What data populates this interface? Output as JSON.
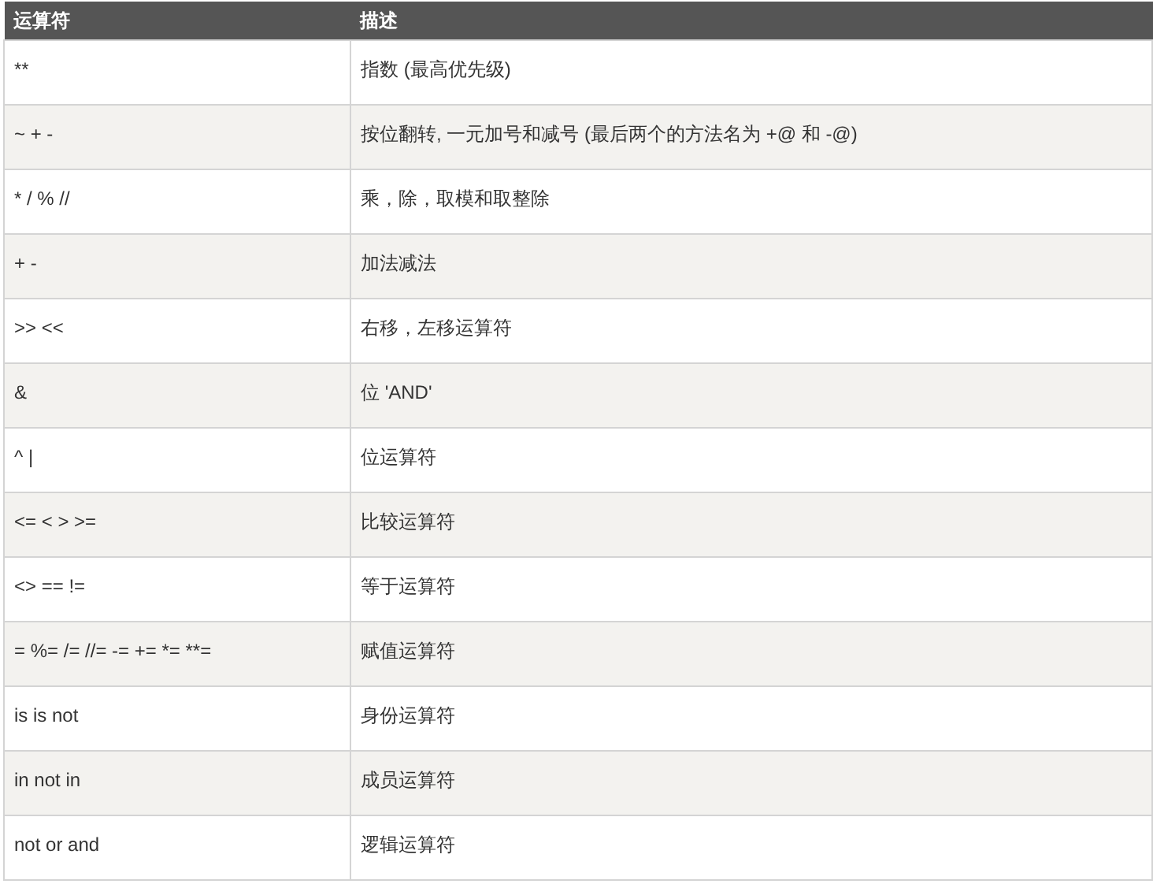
{
  "table": {
    "columns": [
      "运算符",
      "描述"
    ],
    "rows": [
      {
        "operator": "**",
        "description": "指数 (最高优先级)"
      },
      {
        "operator": "~ + -",
        "description": "按位翻转, 一元加号和减号 (最后两个的方法名为 +@ 和 -@)"
      },
      {
        "operator": "* / % //",
        "description": "乘，除，取模和取整除"
      },
      {
        "operator": "+ -",
        "description": "加法减法"
      },
      {
        "operator": ">> <<",
        "description": "右移，左移运算符"
      },
      {
        "operator": "&",
        "description": "位 'AND'"
      },
      {
        "operator": "^ |",
        "description": "位运算符"
      },
      {
        "operator": "<= < > >=",
        "description": "比较运算符"
      },
      {
        "operator": "<> == !=",
        "description": "等于运算符"
      },
      {
        "operator": "= %= /= //= -= += *= **=",
        "description": "赋值运算符"
      },
      {
        "operator": "is is not",
        "description": "身份运算符"
      },
      {
        "operator": "in not in",
        "description": "成员运算符"
      },
      {
        "operator": "not or and",
        "description": "逻辑运算符"
      }
    ]
  }
}
